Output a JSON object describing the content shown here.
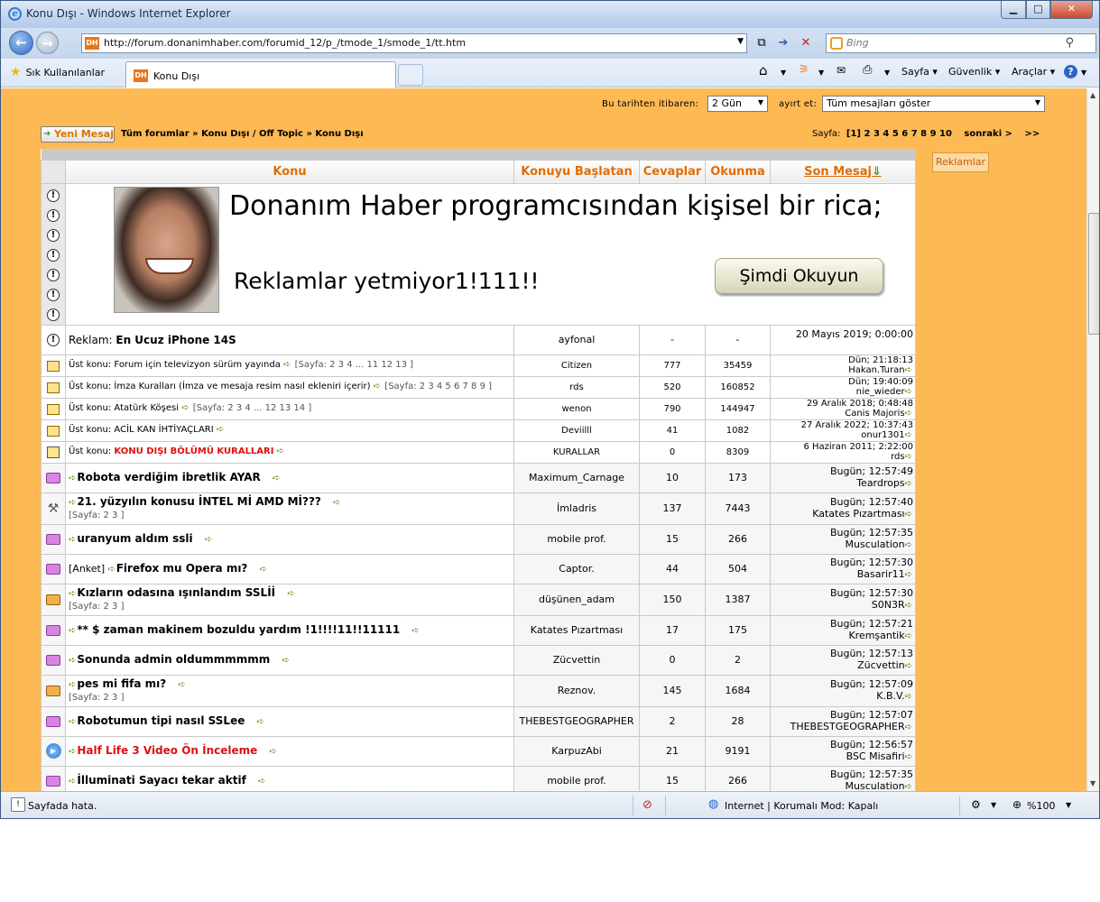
{
  "window": {
    "title": "Konu Dışı - Windows Internet Explorer",
    "min_glyph": "▁",
    "max_glyph": "□",
    "close_glyph": "✕"
  },
  "address_bar": {
    "url": "http://forum.donanimhaber.com/forumid_12/p_/tmode_1/smode_1/tt.htm",
    "site_badge": "DH"
  },
  "search": {
    "placeholder": "Bing"
  },
  "favorites": {
    "label": "Sık Kullanılanlar"
  },
  "tab": {
    "label": "Konu Dışı"
  },
  "commands": {
    "page": "Sayfa",
    "safety": "Güvenlik",
    "tools": "Araçlar"
  },
  "filter": {
    "since_label": "Bu tarihten itibaren:",
    "since_value": "2 Gün",
    "sort_label": "ayırt et:",
    "sort_value": "Tüm mesajları göster"
  },
  "breadcrumb": {
    "new_message": "Yeni Mesaj",
    "path": "Tüm forumlar » Konu Dışı / Off Topic » Konu Dışı"
  },
  "pager": {
    "label": "Sayfa:",
    "current": "[1]",
    "pages": "2 3 4 5 6 7 8 9 10",
    "next": "sonraki >",
    "last": ">>"
  },
  "side_link": "Reklamlar",
  "columns": {
    "topic": "Konu",
    "starter": "Konuyu Başlatan",
    "replies": "Cevaplar",
    "views": "Okunma",
    "last": "Son Mesaj"
  },
  "ad": {
    "headline": "Donanım Haber programcısından kişisel bir rica;",
    "sub": "Reklamlar yetmiyor1!111!!",
    "button": "Şimdi Okuyun"
  },
  "promo_row": {
    "prefix": "Reklam:",
    "title": "En Ucuz iPhone 14S",
    "starter": "ayfonal",
    "replies": "-",
    "views": "-",
    "last": "20 Mayıs 2019; 0:00:00"
  },
  "sticky": [
    {
      "prefix": "Üst konu:",
      "title": "Forum için televizyon sürüm yayında",
      "pages": "[Sayfa: 2 3 4 ... 11 12 13 ]",
      "starter": "Citizen",
      "replies": "777",
      "views": "35459",
      "date": "Dün; 21:18:13",
      "user": "Hakan.Turan"
    },
    {
      "prefix": "Üst konu:",
      "title": "İmza Kuralları (İmza ve mesaja resim nasıl ekleniri içerir)",
      "pages": "[Sayfa: 2 3 4 5 6 7 8 9 ]",
      "starter": "rds",
      "replies": "520",
      "views": "160852",
      "date": "Dün; 19:40:09",
      "user": "nie_wieder"
    },
    {
      "prefix": "Üst konu:",
      "title": "Atatürk Köşesi",
      "pages": "[Sayfa: 2 3 4 ... 12 13 14 ]",
      "starter": "wenon",
      "replies": "790",
      "views": "144947",
      "date": "29 Aralık 2018; 0:48:48",
      "user": "Canis Majoris"
    },
    {
      "prefix": "Üst konu:",
      "title": "ACİL KAN İHTİYAÇLARI",
      "pages": "",
      "starter": "Deviilll",
      "replies": "41",
      "views": "1082",
      "date": "27 Aralık 2022; 10:37:43",
      "user": "onur1301"
    },
    {
      "prefix": "Üst konu:",
      "title": "KONU DIŞI BÖLÜMÜ KURALLARI",
      "pages": "",
      "starter": "KURALLAR",
      "replies": "0",
      "views": "8309",
      "date": "6 Haziran 2011; 2:22:00",
      "user": "rds"
    }
  ],
  "topics": [
    {
      "icon": "folder",
      "prefix": "",
      "title": "Robota verdiğim ibretlik AYAR",
      "pages": "",
      "starter": "Maximum_Carnage",
      "replies": "10",
      "views": "173",
      "date": "Bugün; 12:57:49",
      "user": "Teardrops"
    },
    {
      "icon": "poll",
      "prefix": "",
      "title": "21. yüzyılın konusu İNTEL Mİ AMD Mİ???",
      "pages": "[Sayfa: 2 3 ]",
      "starter": "İmladris",
      "replies": "137",
      "views": "7443",
      "date": "Bugün; 12:57:40",
      "user": "Katates Pızartması"
    },
    {
      "icon": "folder",
      "prefix": "",
      "title": "uranyum aldım ssli",
      "pages": "",
      "starter": "mobile prof.",
      "replies": "15",
      "views": "266",
      "date": "Bugün; 12:57:35",
      "user": "Musculation"
    },
    {
      "icon": "folder",
      "prefix": "[Anket]",
      "title": "Firefox mu Opera mı?",
      "pages": "",
      "starter": "Captor.",
      "replies": "44",
      "views": "504",
      "date": "Bugün; 12:57:30",
      "user": "Basarir11"
    },
    {
      "icon": "hot",
      "prefix": "",
      "title": "Kızların odasına ışınlandım SSLİİ",
      "pages": "[Sayfa: 2 3 ]",
      "starter": "düşünen_adam",
      "replies": "150",
      "views": "1387",
      "date": "Bugün; 12:57:30",
      "user": "S0N3R"
    },
    {
      "icon": "folder",
      "prefix": "",
      "title": "** $ zaman makinem bozuldu yardım !1!!!!11!!11111",
      "pages": "",
      "starter": "Katates Pızartması",
      "replies": "17",
      "views": "175",
      "date": "Bugün; 12:57:21",
      "user": "Kremşantik"
    },
    {
      "icon": "folder",
      "prefix": "",
      "title": "Sonunda admin oldummmmmm",
      "pages": "",
      "starter": "Zücvettin",
      "replies": "0",
      "views": "2",
      "date": "Bugün; 12:57:13",
      "user": "Zücvettin"
    },
    {
      "icon": "hot",
      "prefix": "",
      "title": "pes mi fifa mı?",
      "pages": "[Sayfa: 2 3 ]",
      "starter": "Reznov.",
      "replies": "145",
      "views": "1684",
      "date": "Bugün; 12:57:09",
      "user": "K.B.V."
    },
    {
      "icon": "folder",
      "prefix": "",
      "title": "Robotumun tipi nasıl SSLee",
      "pages": "",
      "starter": "THEBESTGEOGRAPHER",
      "replies": "2",
      "views": "28",
      "date": "Bugün; 12:57:07",
      "user": "THEBESTGEOGRAPHER"
    },
    {
      "icon": "video",
      "prefix": "",
      "title": "Half Life 3 Video Ön İnceleme",
      "pages": "",
      "starter": "KarpuzAbi",
      "replies": "21",
      "views": "9191",
      "date": "Bugün; 12:56:57",
      "user": "BSC Misafiri"
    },
    {
      "icon": "folder",
      "prefix": "",
      "title": "İlluminati Sayacı tekar aktif",
      "pages": "",
      "starter": "mobile prof.",
      "replies": "15",
      "views": "266",
      "date": "Bugün; 12:57:35",
      "user": "Musculation"
    }
  ],
  "statusbar": {
    "text": "Sayfada hata.",
    "zone": "Internet | Korumalı Mod: Kapalı",
    "zoom": "%100"
  }
}
